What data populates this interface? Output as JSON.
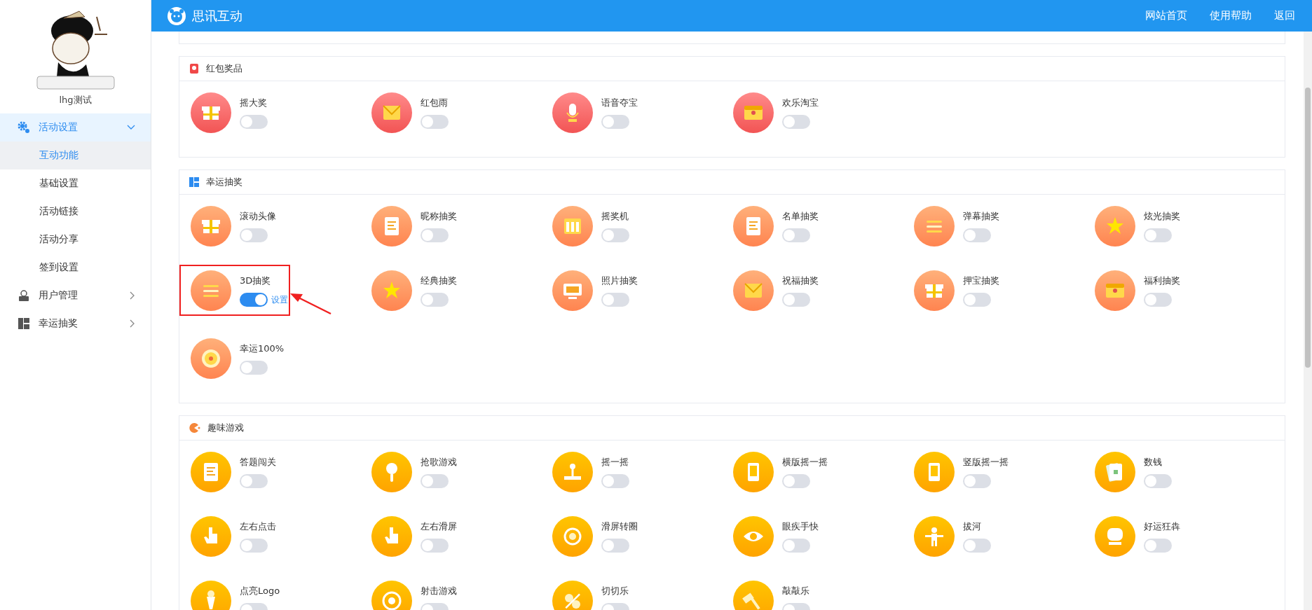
{
  "header": {
    "title": "思讯互动",
    "links": [
      "网站首页",
      "使用帮助",
      "返回"
    ]
  },
  "sidebar": {
    "user": "lhg测试",
    "menu": [
      {
        "label": "活动设置",
        "expanded": true,
        "selected": true,
        "children": [
          {
            "label": "互动功能",
            "selected": true
          },
          {
            "label": "基础设置",
            "selected": false
          },
          {
            "label": "活动链接",
            "selected": false
          },
          {
            "label": "活动分享",
            "selected": false
          },
          {
            "label": "签到设置",
            "selected": false
          }
        ]
      },
      {
        "label": "用户管理",
        "expanded": false,
        "selected": false
      },
      {
        "label": "幸运抽奖",
        "expanded": false,
        "selected": false
      }
    ]
  },
  "sections": [
    {
      "kind": "prize",
      "title": "红包奖品",
      "items": [
        {
          "title": "摇大奖",
          "on": false,
          "highlighted": false
        },
        {
          "title": "红包雨",
          "on": false,
          "highlighted": false
        },
        {
          "title": "语音夺宝",
          "on": false,
          "highlighted": false
        },
        {
          "title": "欢乐淘宝",
          "on": false,
          "highlighted": false
        }
      ]
    },
    {
      "kind": "lottery",
      "title": "幸运抽奖",
      "items": [
        {
          "title": "滚动头像",
          "on": false,
          "highlighted": false
        },
        {
          "title": "昵称抽奖",
          "on": false,
          "highlighted": false
        },
        {
          "title": "摇奖机",
          "on": false,
          "highlighted": false
        },
        {
          "title": "名单抽奖",
          "on": false,
          "highlighted": false
        },
        {
          "title": "弹幕抽奖",
          "on": false,
          "highlighted": false
        },
        {
          "title": "炫光抽奖",
          "on": false,
          "highlighted": false
        },
        {
          "title": "3D抽奖",
          "on": true,
          "highlighted": true,
          "link": "设置"
        },
        {
          "title": "经典抽奖",
          "on": false,
          "highlighted": false
        },
        {
          "title": "照片抽奖",
          "on": false,
          "highlighted": false
        },
        {
          "title": "祝福抽奖",
          "on": false,
          "highlighted": false
        },
        {
          "title": "押宝抽奖",
          "on": false,
          "highlighted": false
        },
        {
          "title": "福利抽奖",
          "on": false,
          "highlighted": false
        },
        {
          "title": "幸运100%",
          "on": false,
          "highlighted": false
        }
      ]
    },
    {
      "kind": "game",
      "title": "趣味游戏",
      "items": [
        {
          "title": "答题闯关",
          "on": false,
          "highlighted": false
        },
        {
          "title": "抢歌游戏",
          "on": false,
          "highlighted": false
        },
        {
          "title": "摇一摇",
          "on": false,
          "highlighted": false
        },
        {
          "title": "横版摇一摇",
          "on": false,
          "highlighted": false
        },
        {
          "title": "竖版摇一摇",
          "on": false,
          "highlighted": false
        },
        {
          "title": "数钱",
          "on": false,
          "highlighted": false
        },
        {
          "title": "左右点击",
          "on": false,
          "highlighted": false
        },
        {
          "title": "左右滑屏",
          "on": false,
          "highlighted": false
        },
        {
          "title": "滑屏转圈",
          "on": false,
          "highlighted": false
        },
        {
          "title": "眼疾手快",
          "on": false,
          "highlighted": false
        },
        {
          "title": "拔河",
          "on": false,
          "highlighted": false
        },
        {
          "title": "好运狂犇",
          "on": false,
          "highlighted": false
        },
        {
          "title": "点亮Logo",
          "on": false,
          "highlighted": false
        },
        {
          "title": "射击游戏",
          "on": false,
          "highlighted": false
        },
        {
          "title": "切切乐",
          "on": false,
          "highlighted": false
        },
        {
          "title": "敲敲乐",
          "on": false,
          "highlighted": false
        }
      ]
    }
  ]
}
